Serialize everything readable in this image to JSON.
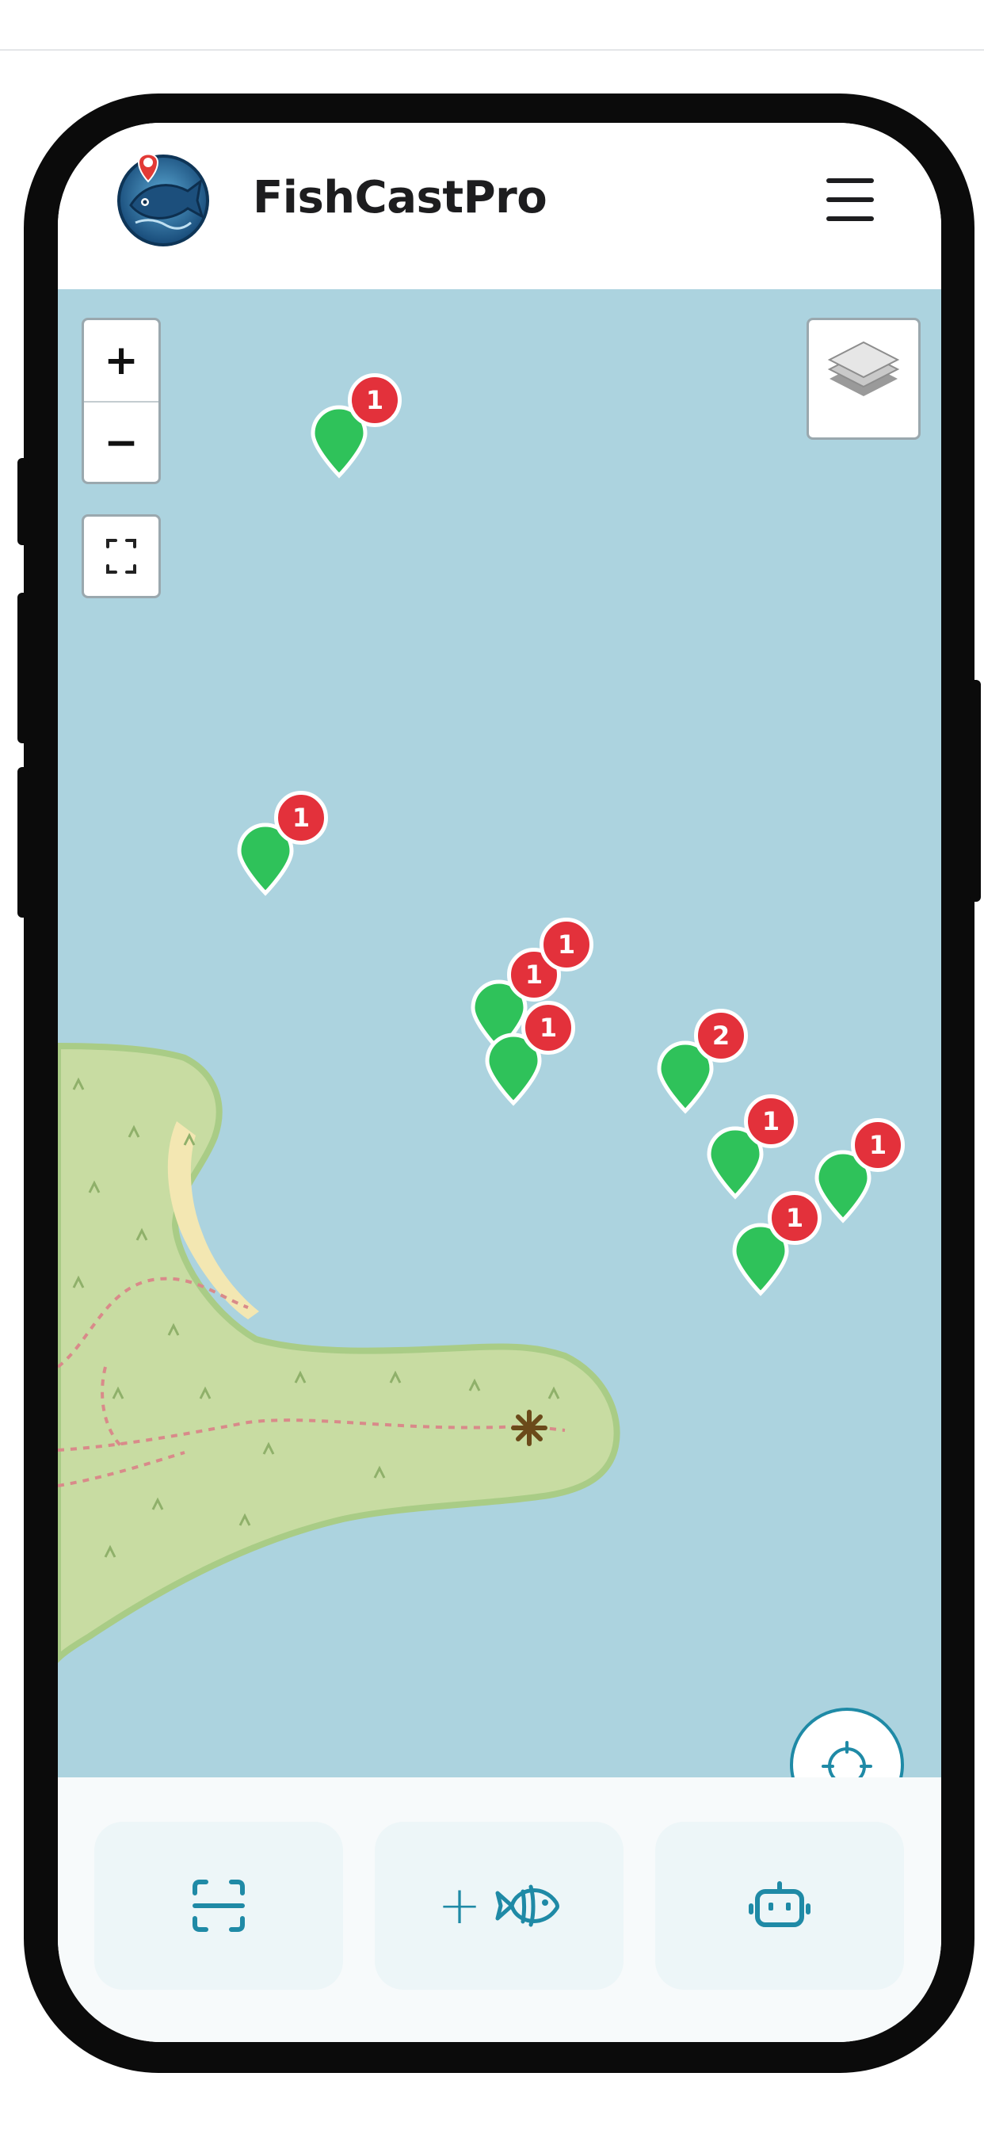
{
  "app": {
    "title": "FishCastPro"
  },
  "header": {
    "logo_icon": "fish-location-logo-icon",
    "menu_icon": "hamburger-menu-icon"
  },
  "map_controls": {
    "zoom_in_label": "+",
    "zoom_out_label": "−",
    "fullscreen_icon": "fullscreen-icon",
    "layers_icon": "layers-icon",
    "locate_icon": "crosshair-icon"
  },
  "markers": [
    {
      "count": "1"
    },
    {
      "count": "1"
    },
    {
      "count": "1"
    },
    {
      "count": "1"
    },
    {
      "count": "1"
    },
    {
      "count": "2"
    },
    {
      "count": "1"
    },
    {
      "count": "1"
    },
    {
      "count": "1"
    }
  ],
  "bottom_actions": [
    {
      "icon": "scan-icon"
    },
    {
      "label": "+",
      "icon": "fish-icon"
    },
    {
      "icon": "robot-icon"
    }
  ],
  "colors": {
    "water": "#acd3df",
    "land": "#c8dca2",
    "marker_green": "#2fc25a",
    "badge_red": "#e3313b",
    "accent_teal": "#1f8aa6"
  }
}
